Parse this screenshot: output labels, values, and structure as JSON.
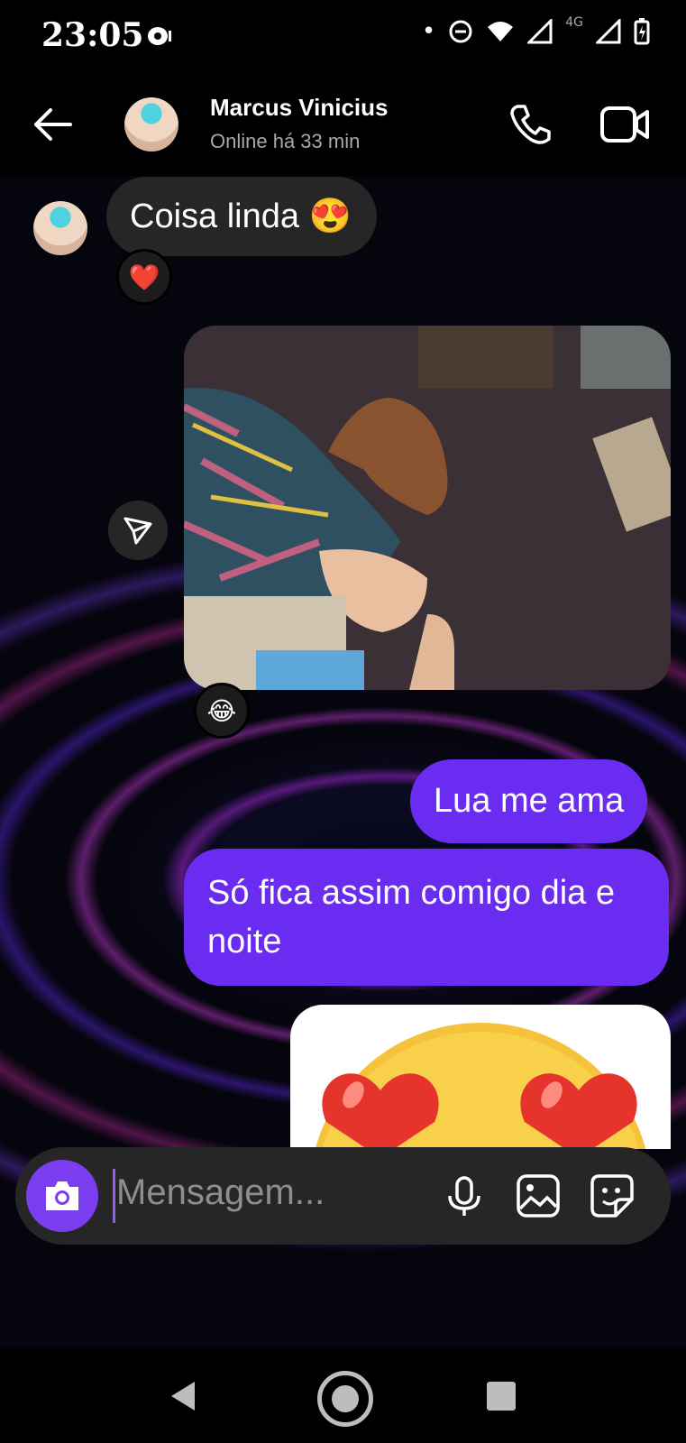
{
  "status_bar": {
    "time": "23:05",
    "network": "4G"
  },
  "header": {
    "contact_name": "Marcus Vinicius",
    "contact_status": "Online há 33 min"
  },
  "messages": [
    {
      "type": "incoming_text",
      "text": "Coisa linda 😍",
      "reaction": "❤️"
    },
    {
      "type": "incoming_photo",
      "reaction": "😂"
    },
    {
      "type": "outgoing_text",
      "text": "Lua me ama"
    },
    {
      "type": "outgoing_text",
      "text": "Só fica assim comigo dia e noite"
    },
    {
      "type": "outgoing_sticker",
      "emoji": "heart-eyes"
    }
  ],
  "composer": {
    "placeholder": "Mensagem..."
  },
  "colors": {
    "outgoing_bubble": "#6a2cf0",
    "incoming_bubble": "#262626",
    "camera_button": "#7b3df0"
  }
}
